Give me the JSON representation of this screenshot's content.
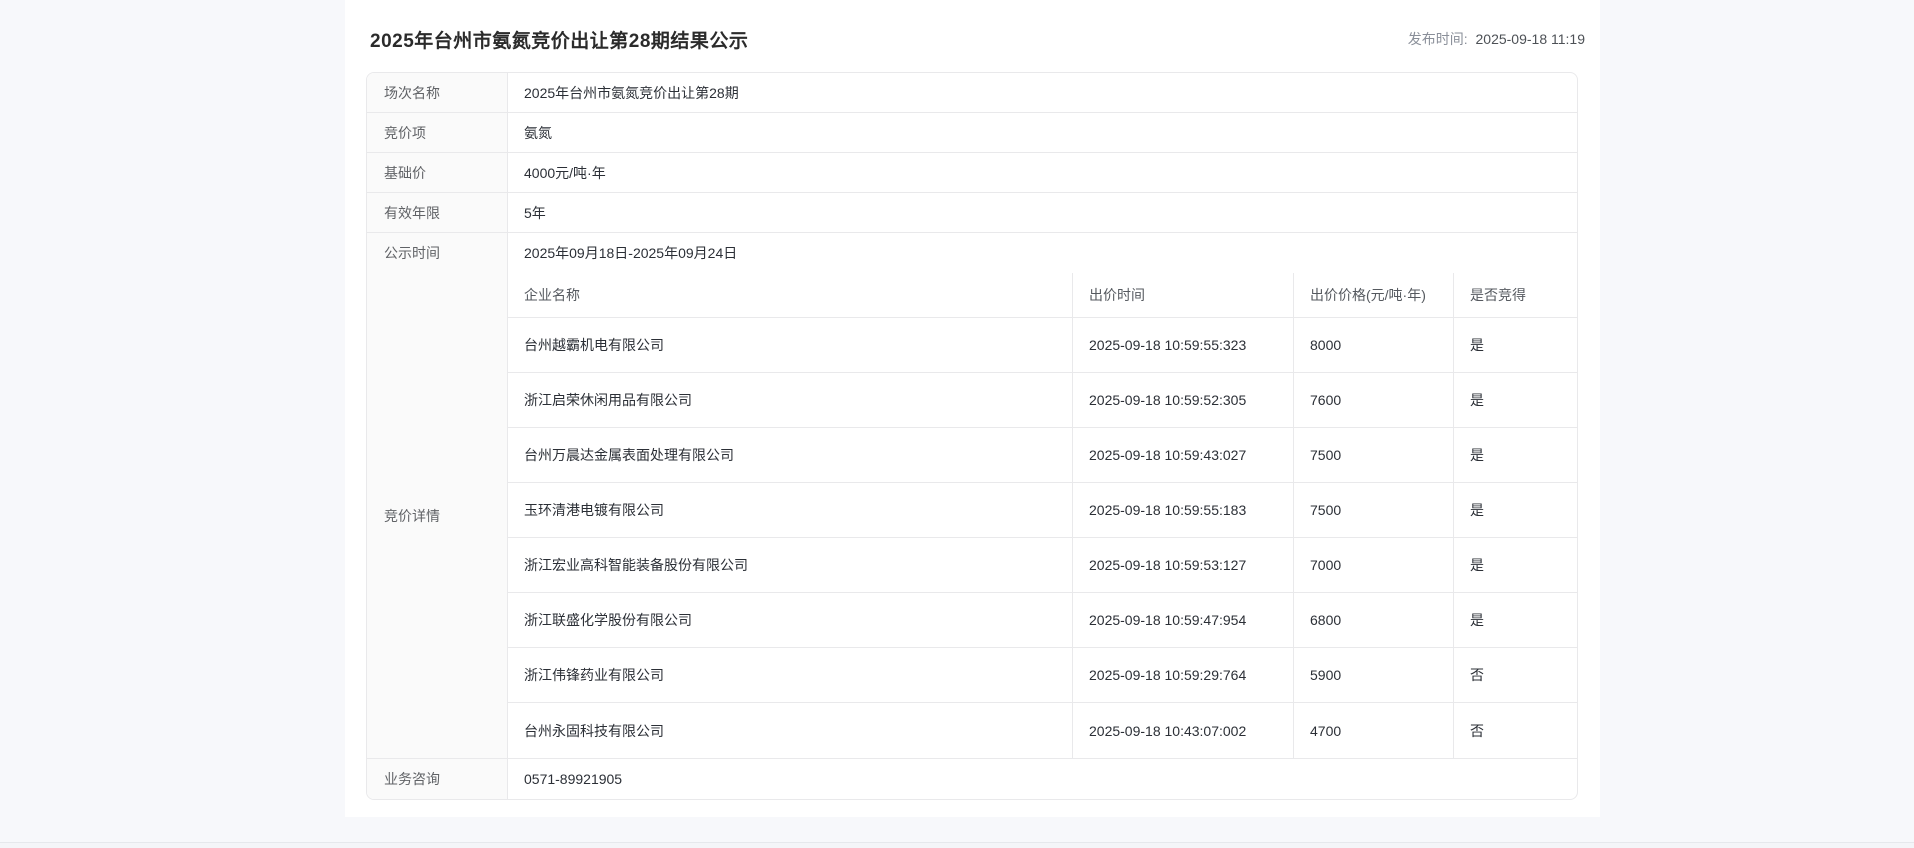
{
  "page": {
    "title": "2025年台州市氨氮竞价出让第28期结果公示",
    "publish_label": "发布时间:",
    "publish_time": "2025-09-18 11:19"
  },
  "info_rows": [
    {
      "label": "场次名称",
      "value": "2025年台州市氨氮竞价出让第28期"
    },
    {
      "label": "竞价项",
      "value": "氨氮"
    },
    {
      "label": "基础价",
      "value": "4000元/吨·年"
    },
    {
      "label": "有效年限",
      "value": "5年"
    },
    {
      "label": "公示时间",
      "value": "2025年09月18日-2025年09月24日"
    }
  ],
  "bid_details": {
    "label": "竞价详情",
    "columns": [
      "企业名称",
      "出价时间",
      "出价价格(元/吨·年)",
      "是否竞得"
    ],
    "rows": [
      {
        "company": "台州越霸机电有限公司",
        "bid_time": "2025-09-18 10:59:55:323",
        "price": "8000",
        "won": "是"
      },
      {
        "company": "浙江启荣休闲用品有限公司",
        "bid_time": "2025-09-18 10:59:52:305",
        "price": "7600",
        "won": "是"
      },
      {
        "company": "台州万晨达金属表面处理有限公司",
        "bid_time": "2025-09-18 10:59:43:027",
        "price": "7500",
        "won": "是"
      },
      {
        "company": "玉环清港电镀有限公司",
        "bid_time": "2025-09-18 10:59:55:183",
        "price": "7500",
        "won": "是"
      },
      {
        "company": "浙江宏业高科智能装备股份有限公司",
        "bid_time": "2025-09-18 10:59:53:127",
        "price": "7000",
        "won": "是"
      },
      {
        "company": "浙江联盛化学股份有限公司",
        "bid_time": "2025-09-18 10:59:47:954",
        "price": "6800",
        "won": "是"
      },
      {
        "company": "浙江伟锋药业有限公司",
        "bid_time": "2025-09-18 10:59:29:764",
        "price": "5900",
        "won": "否"
      },
      {
        "company": "台州永固科技有限公司",
        "bid_time": "2025-09-18 10:43:07:002",
        "price": "4700",
        "won": "否"
      }
    ]
  },
  "contact_row": {
    "label": "业务咨询",
    "value": "0571-89921905"
  },
  "colors": {
    "page_bg": "#f7f8fb",
    "card_bg": "#ffffff",
    "label_bg": "#fafafa",
    "border": "#e9e9eb",
    "title_text": "#2b2b2b",
    "label_text": "#606266",
    "value_text": "#2b2f36",
    "publish_label_text": "#8a8f99"
  }
}
